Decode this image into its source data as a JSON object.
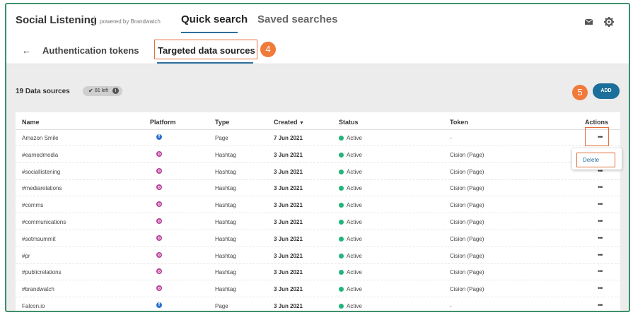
{
  "header": {
    "brand": "Social Listening",
    "brand_sub": "powered by Brandwatch",
    "tabs": [
      {
        "label": "Quick search",
        "active": true
      },
      {
        "label": "Saved searches",
        "active": false
      }
    ]
  },
  "subnav": {
    "tabs": [
      {
        "label": "Authentication tokens"
      },
      {
        "label": "Targeted data sources",
        "active": true
      }
    ]
  },
  "callouts": [
    "4",
    "5"
  ],
  "toolbar": {
    "count_label": "19 Data sources",
    "quota_label": "81 left",
    "add_label": "ADD"
  },
  "table": {
    "columns": [
      "Name",
      "Platform",
      "Type",
      "Created",
      "Status",
      "Token",
      "Actions"
    ],
    "sort_indicator": "▼",
    "rows": [
      {
        "name": "Amazon Smile",
        "platform": "facebook",
        "type": "Page",
        "created": "7 Jun 2021",
        "status": "Active",
        "token": "-"
      },
      {
        "name": "#earnedmedia",
        "platform": "instagram",
        "type": "Hashtag",
        "created": "3 Jun 2021",
        "status": "Active",
        "token": "Cision (Page)"
      },
      {
        "name": "#sociallistening",
        "platform": "instagram",
        "type": "Hashtag",
        "created": "3 Jun 2021",
        "status": "Active",
        "token": "Cision (Page)"
      },
      {
        "name": "#mediarelations",
        "platform": "instagram",
        "type": "Hashtag",
        "created": "3 Jun 2021",
        "status": "Active",
        "token": "Cision (Page)"
      },
      {
        "name": "#comms",
        "platform": "instagram",
        "type": "Hashtag",
        "created": "3 Jun 2021",
        "status": "Active",
        "token": "Cision (Page)"
      },
      {
        "name": "#communications",
        "platform": "instagram",
        "type": "Hashtag",
        "created": "3 Jun 2021",
        "status": "Active",
        "token": "Cision (Page)"
      },
      {
        "name": "#sotmsummit",
        "platform": "instagram",
        "type": "Hashtag",
        "created": "3 Jun 2021",
        "status": "Active",
        "token": "Cision (Page)"
      },
      {
        "name": "#pr",
        "platform": "instagram",
        "type": "Hashtag",
        "created": "3 Jun 2021",
        "status": "Active",
        "token": "Cision (Page)"
      },
      {
        "name": "#publicrelations",
        "platform": "instagram",
        "type": "Hashtag",
        "created": "3 Jun 2021",
        "status": "Active",
        "token": "Cision (Page)"
      },
      {
        "name": "#brandwatch",
        "platform": "instagram",
        "type": "Hashtag",
        "created": "3 Jun 2021",
        "status": "Active",
        "token": "Cision (Page)"
      },
      {
        "name": "Falcon.io",
        "platform": "facebook",
        "type": "Page",
        "created": "3 Jun 2021",
        "status": "Active",
        "token": "-"
      }
    ],
    "row_menu": {
      "items": [
        "Delete"
      ]
    }
  },
  "colors": {
    "accent": "#1c6e9b",
    "active_status": "#21b57a",
    "annotation": "#e36f3d",
    "facebook": "#2d6fd1",
    "instagram": "#b83d9b"
  }
}
